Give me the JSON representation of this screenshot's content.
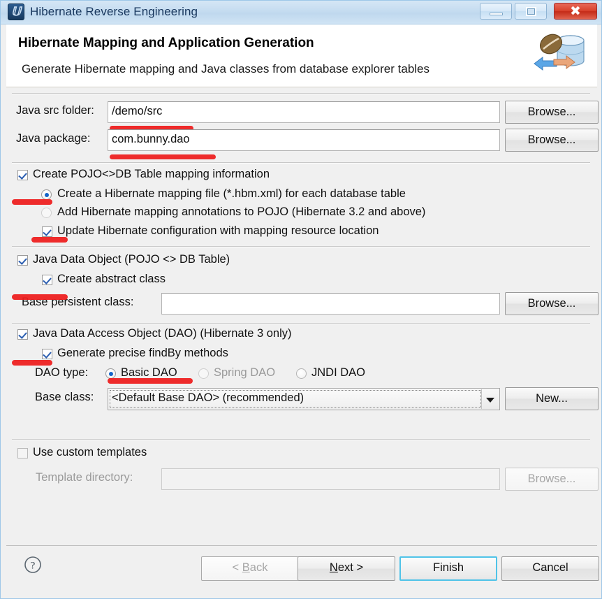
{
  "window": {
    "title": "Hibernate Reverse Engineering",
    "app_icon": "hibernate-icon",
    "controls": {
      "minimize": "minimize-icon",
      "maximize": "maximize-icon",
      "close": "close-icon"
    }
  },
  "header": {
    "title": "Hibernate Mapping and Application Generation",
    "subtitle": "Generate Hibernate mapping and Java classes from database explorer tables",
    "icon": "java-to-database-icon"
  },
  "fields": {
    "src_folder": {
      "label": "Java src folder:",
      "value": "/demo/src",
      "browse_label": "Browse..."
    },
    "package": {
      "label": "Java package:",
      "value": "com.bunny.dao",
      "placeholder": "",
      "browse_label": "Browse..."
    },
    "base_persistent_class": {
      "label": "Base persistent class:",
      "value": "",
      "browse_label": "Browse..."
    },
    "base_class": {
      "label": "Base class:",
      "value": "<Default Base DAO> (recommended)",
      "new_label": "New..."
    },
    "template_directory": {
      "label": "Template directory:",
      "value": "",
      "browse_label": "Browse..."
    }
  },
  "options": {
    "create_mapping": {
      "label": "Create POJO<>DB Table mapping information",
      "checked": true
    },
    "mapping_file_radio": {
      "label": "Create a Hibernate mapping file (*.hbm.xml) for each database table",
      "selected": true
    },
    "annotations_radio": {
      "label": "Add Hibernate mapping annotations to POJO (Hibernate 3.2 and above)",
      "selected": false
    },
    "update_config": {
      "label": "Update Hibernate configuration with mapping resource location",
      "checked": true
    },
    "java_data_object": {
      "label": "Java Data Object (POJO <> DB Table)",
      "checked": true
    },
    "create_abstract_class": {
      "label": "Create abstract class",
      "checked": true
    },
    "java_dao": {
      "label": "Java Data Access Object (DAO) (Hibernate 3 only)",
      "checked": true
    },
    "generate_findby": {
      "label": "Generate precise findBy methods",
      "checked": true
    },
    "dao_type": {
      "label": "DAO type:",
      "choices": [
        {
          "label": "Basic DAO",
          "selected": true,
          "enabled": true
        },
        {
          "label": "Spring DAO",
          "selected": false,
          "enabled": false
        },
        {
          "label": "JNDI DAO",
          "selected": false,
          "enabled": true
        }
      ]
    },
    "use_custom_templates": {
      "label": "Use custom templates",
      "checked": false
    }
  },
  "footer": {
    "help_icon": "help-question-icon",
    "buttons": {
      "back": {
        "prefix": "< ",
        "mnemonic": "B",
        "suffix": "ack",
        "enabled": false
      },
      "next": {
        "prefix": "",
        "mnemonic": "N",
        "suffix": "ext >",
        "enabled": true
      },
      "finish": "Finish",
      "cancel": "Cancel"
    }
  },
  "colors": {
    "accent": "#4fc3e8",
    "titlebar": "#c5dcf0",
    "close_button": "#d8412b",
    "annotation_red": "#ee1c1c",
    "checkmark": "#2a5db0",
    "radio_dot": "#1464c8"
  }
}
